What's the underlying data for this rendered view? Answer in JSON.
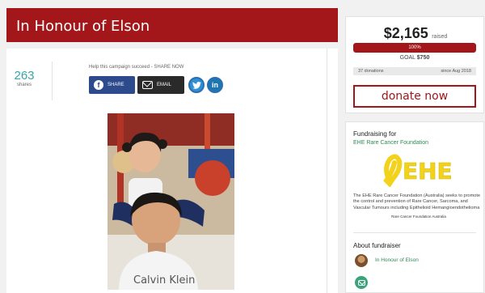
{
  "campaign": {
    "title": "In Honour of Elson"
  },
  "shares": {
    "count": "263",
    "label": "shares"
  },
  "share_bar": {
    "prompt": "Help this campaign succeed - SHARE NOW",
    "facebook_label": "SHARE",
    "email_label": "EMAIL"
  },
  "fundraising": {
    "raised_amount": "$2,165",
    "raised_word": "raised",
    "progress_percent": 100,
    "progress_label": "100%",
    "goal_label": "GOAL",
    "goal_value": "$750",
    "donations": "37 donations",
    "since": "since Aug 2018",
    "donate_label": "donate now"
  },
  "charity": {
    "heading": "Fundraising for",
    "org_name": "EHE Rare Cancer Foundation",
    "logo_text": "EHE",
    "logo_caption": "Rare Cancer Foundation Australia",
    "description": "The EHE Rare Cancer Foundation (Australia) seeks to promote the control and prevention of Rare Cancer, Sarcoma, and Vascular Tumours including Epithelioid Hemangioendothelioma"
  },
  "fundraiser": {
    "heading": "About fundraiser",
    "name": "In Honour of Elson"
  },
  "photo": {
    "shirt_text": "Calvin Klein"
  },
  "colors": {
    "brand": "#a3161a",
    "teal": "#3aa3a3",
    "green": "#2e8b57",
    "logo_yellow": "#f2d21b"
  }
}
